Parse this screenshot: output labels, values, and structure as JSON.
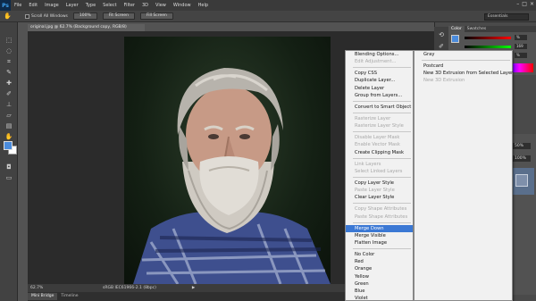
{
  "app": {
    "logo": "Ps"
  },
  "menubar": {
    "items": [
      "File",
      "Edit",
      "Image",
      "Layer",
      "Type",
      "Select",
      "Filter",
      "3D",
      "View",
      "Window",
      "Help"
    ]
  },
  "options": {
    "scroll_all_label": "Scroll All Windows",
    "btn_100": "100%",
    "btn_fit": "Fit Screen",
    "btn_fill": "Fill Screen",
    "workspace": "Essentials"
  },
  "document": {
    "tab_title": "original.jpg @ 62.7% (Background copy, RGB/8)",
    "zoom": "62.7%",
    "doc_info": "sRGB IEC61966-2.1 (8bpc)"
  },
  "bottom_tabs": [
    "Mini Bridge",
    "Timeline"
  ],
  "color_panel": {
    "tabs": [
      "Color",
      "Swatches"
    ],
    "values": [
      "%",
      "169",
      "%"
    ]
  },
  "layers": {
    "opacity": "50%",
    "fill": "100%"
  },
  "context_menu": {
    "items": [
      {
        "label": "Blending Options...",
        "state": "normal"
      },
      {
        "label": "Edit Adjustment...",
        "state": "disabled"
      },
      {
        "sep": true
      },
      {
        "label": "Copy CSS",
        "state": "normal"
      },
      {
        "label": "Duplicate Layer...",
        "state": "normal"
      },
      {
        "label": "Delete Layer",
        "state": "normal"
      },
      {
        "label": "Group from Layers...",
        "state": "normal"
      },
      {
        "sep": true
      },
      {
        "label": "Convert to Smart Object",
        "state": "normal"
      },
      {
        "sep": true
      },
      {
        "label": "Rasterize Layer",
        "state": "disabled"
      },
      {
        "label": "Rasterize Layer Style",
        "state": "disabled"
      },
      {
        "sep": true
      },
      {
        "label": "Disable Layer Mask",
        "state": "disabled"
      },
      {
        "label": "Enable Vector Mask",
        "state": "disabled"
      },
      {
        "label": "Create Clipping Mask",
        "state": "normal"
      },
      {
        "sep": true
      },
      {
        "label": "Link Layers",
        "state": "disabled"
      },
      {
        "label": "Select Linked Layers",
        "state": "disabled"
      },
      {
        "sep": true
      },
      {
        "label": "Copy Layer Style",
        "state": "normal"
      },
      {
        "label": "Paste Layer Style",
        "state": "disabled"
      },
      {
        "label": "Clear Layer Style",
        "state": "normal"
      },
      {
        "sep": true
      },
      {
        "label": "Copy Shape Attributes",
        "state": "disabled"
      },
      {
        "label": "Paste Shape Attributes",
        "state": "disabled"
      },
      {
        "sep": true
      },
      {
        "label": "Merge Down",
        "state": "highlight"
      },
      {
        "label": "Merge Visible",
        "state": "normal"
      },
      {
        "label": "Flatten Image",
        "state": "normal"
      },
      {
        "sep": true
      },
      {
        "label": "No Color",
        "state": "normal"
      },
      {
        "label": "Red",
        "state": "normal"
      },
      {
        "label": "Orange",
        "state": "normal"
      },
      {
        "label": "Yellow",
        "state": "normal"
      },
      {
        "label": "Green",
        "state": "normal"
      },
      {
        "label": "Blue",
        "state": "normal"
      },
      {
        "label": "Violet",
        "state": "normal"
      }
    ]
  },
  "submenu": {
    "items": [
      {
        "label": "Gray",
        "state": "normal"
      },
      {
        "sep": true
      },
      {
        "label": "Postcard",
        "state": "normal"
      },
      {
        "label": "New 3D Extrusion from Selected Layer",
        "state": "normal"
      },
      {
        "label": "New 3D Extrusion",
        "state": "disabled"
      }
    ]
  },
  "colors": {
    "foreground": "#4a8bdc",
    "background": "#ffffff",
    "highlight": "#3b78d4"
  }
}
